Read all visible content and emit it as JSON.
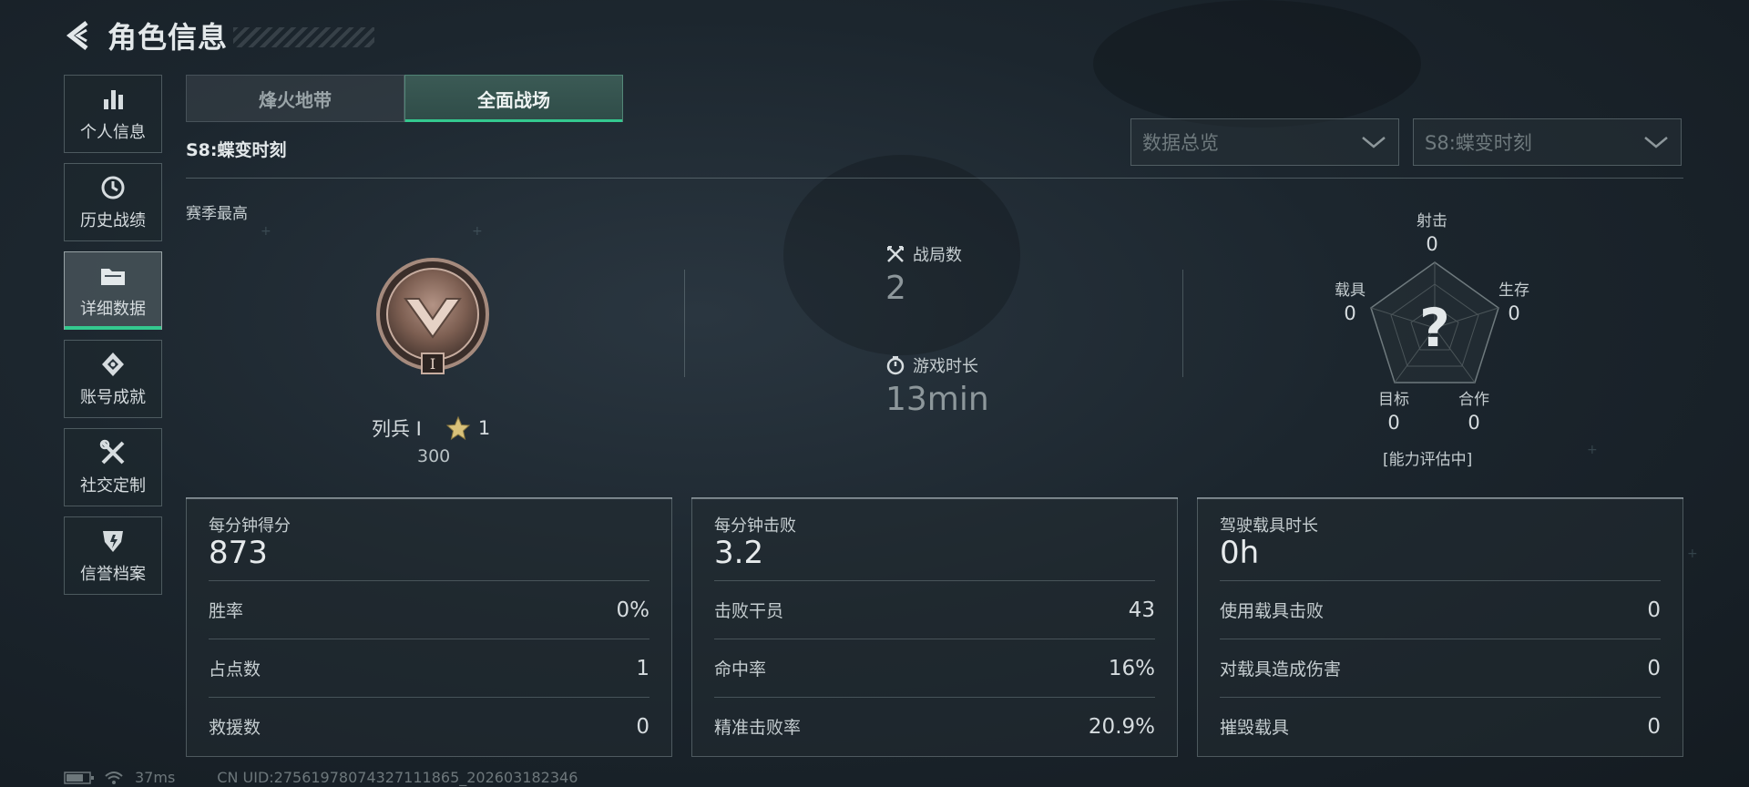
{
  "header": {
    "title": "角色信息"
  },
  "sidebar": {
    "items": [
      {
        "label": "个人信息",
        "icon": "bar-chart-icon"
      },
      {
        "label": "历史战绩",
        "icon": "history-icon"
      },
      {
        "label": "详细数据",
        "icon": "folder-icon",
        "active": true
      },
      {
        "label": "账号成就",
        "icon": "achievement-icon"
      },
      {
        "label": "社交定制",
        "icon": "tools-icon"
      },
      {
        "label": "信誉档案",
        "icon": "shield-icon"
      }
    ]
  },
  "tabs": [
    {
      "label": "烽火地带",
      "active": false
    },
    {
      "label": "全面战场",
      "active": true
    }
  ],
  "season": {
    "label": "S8:蝶变时刻"
  },
  "filters": {
    "category": {
      "value": "数据总览",
      "icon": "chevron-down-icon"
    },
    "season": {
      "value": "S8:蝶变时刻",
      "icon": "chevron-down-icon"
    }
  },
  "best": {
    "label": "赛季最高",
    "rank_name": "列兵 I",
    "stars": "1",
    "points": "300",
    "badge_numeral": "I"
  },
  "summary": {
    "matches": {
      "label": "战局数",
      "value": "2",
      "icon": "crossed-swords-icon"
    },
    "playtime": {
      "label": "游戏时长",
      "value": "13min",
      "icon": "stopwatch-icon"
    }
  },
  "radar": {
    "axes": [
      {
        "label": "射击",
        "value": "0"
      },
      {
        "label": "生存",
        "value": "0"
      },
      {
        "label": "合作",
        "value": "0"
      },
      {
        "label": "目标",
        "value": "0"
      },
      {
        "label": "载具",
        "value": "0"
      }
    ],
    "center": "?",
    "status": "[能力评估中]"
  },
  "cards": [
    {
      "head_label": "每分钟得分",
      "head_value": "873",
      "rows": [
        {
          "k": "胜率",
          "v": "0%"
        },
        {
          "k": "占点数",
          "v": "1"
        },
        {
          "k": "救援数",
          "v": "0"
        }
      ]
    },
    {
      "head_label": "每分钟击败",
      "head_value": "3.2",
      "rows": [
        {
          "k": "击败干员",
          "v": "43"
        },
        {
          "k": "命中率",
          "v": "16%"
        },
        {
          "k": "精准击败率",
          "v": "20.9%"
        }
      ]
    },
    {
      "head_label": "驾驶载具时长",
      "head_value": "0h",
      "rows": [
        {
          "k": "使用载具击败",
          "v": "0"
        },
        {
          "k": "对载具造成伤害",
          "v": "0"
        },
        {
          "k": "摧毁载具",
          "v": "0"
        }
      ]
    }
  ],
  "footer": {
    "ping": "37ms",
    "uid": "CN UID:27561978074327111865_202603182346"
  },
  "colors": {
    "accent": "#34c98f",
    "panel_border": "#aab9be",
    "gold_star": "#d9c27a",
    "badge_bronze": "#8a6a5c"
  }
}
